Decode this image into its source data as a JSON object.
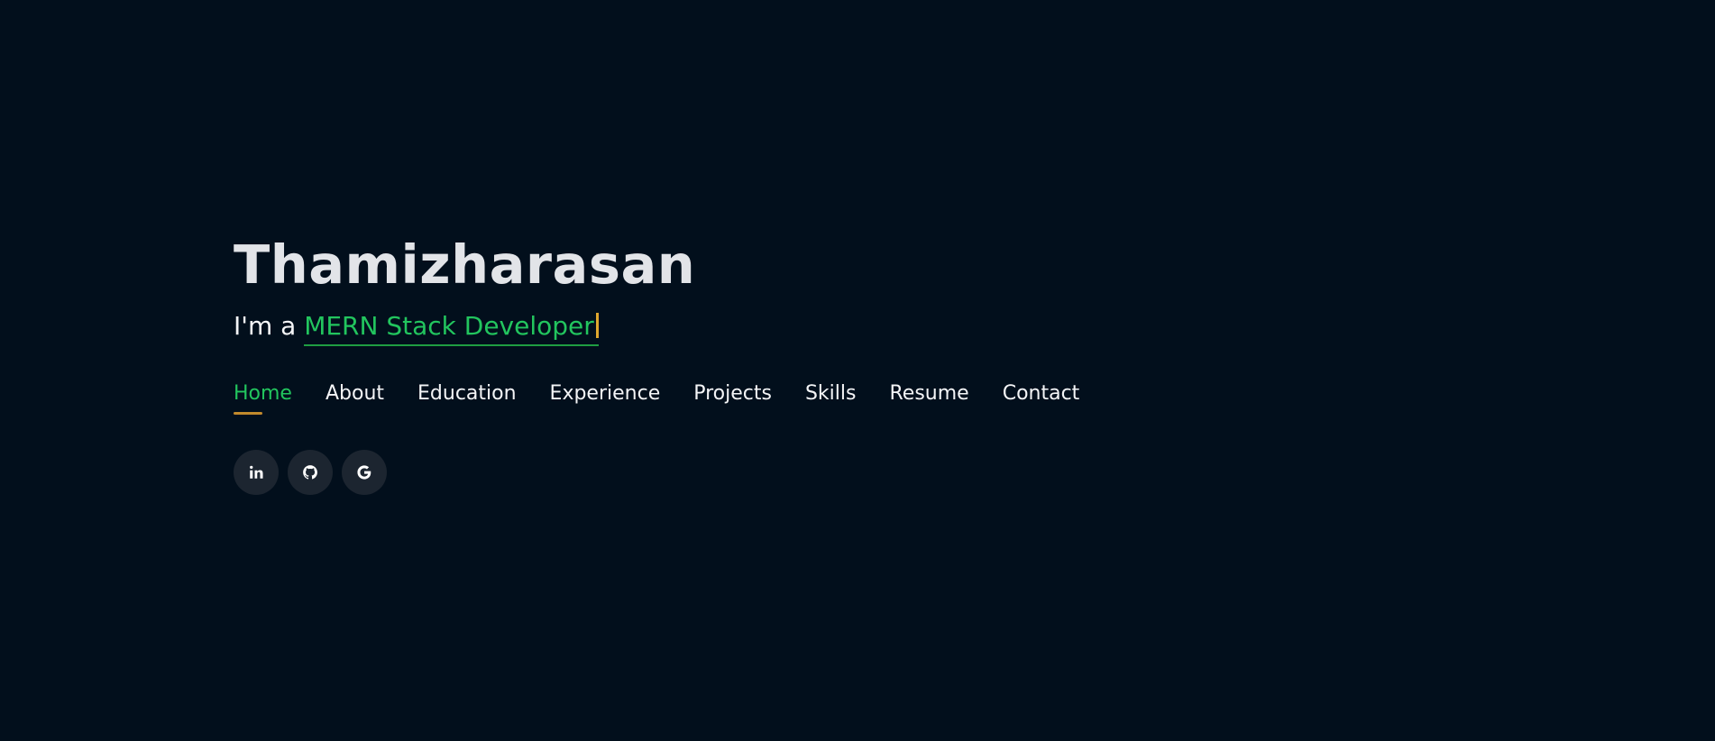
{
  "hero": {
    "name": "Thamizharasan",
    "tagline_prefix": "I'm a ",
    "tagline_role": "MERN Stack Developer"
  },
  "nav": {
    "items": [
      {
        "label": "Home",
        "active": true
      },
      {
        "label": "About"
      },
      {
        "label": "Education"
      },
      {
        "label": "Experience"
      },
      {
        "label": "Projects"
      },
      {
        "label": "Skills"
      },
      {
        "label": "Resume"
      },
      {
        "label": "Contact"
      }
    ]
  },
  "social": {
    "icons": [
      "linkedin-icon",
      "github-icon",
      "google-icon"
    ]
  },
  "colors": {
    "background": "#020f1c",
    "accent": "#22c55e",
    "cursor": "#e0a82e",
    "underline": "#c28a2c"
  }
}
